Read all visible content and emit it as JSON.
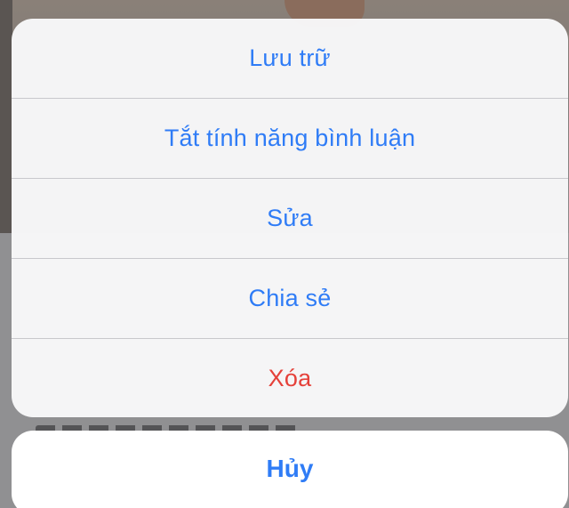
{
  "action_sheet": {
    "items": [
      {
        "label": "Lưu trữ",
        "style": "default"
      },
      {
        "label": "Tắt tính năng bình luận",
        "style": "default"
      },
      {
        "label": "Sửa",
        "style": "default"
      },
      {
        "label": "Chia sẻ",
        "style": "default"
      },
      {
        "label": "Xóa",
        "style": "destructive"
      }
    ],
    "cancel_label": "Hủy"
  },
  "colors": {
    "action_blue": "#2f7cf6",
    "destructive_red": "#e5413a",
    "sheet_background": "#f8f8f9",
    "overlay": "#8f8f91"
  }
}
